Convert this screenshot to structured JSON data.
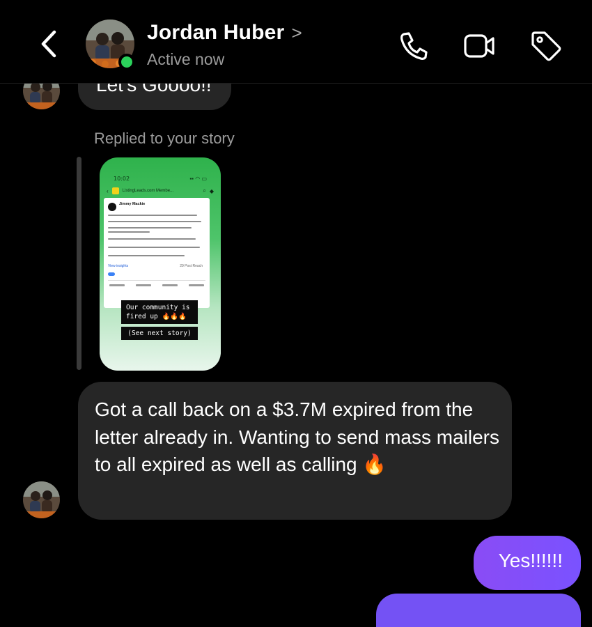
{
  "header": {
    "back_icon": "chevron-left-icon",
    "contact_name": "Jordan Huber",
    "name_chevron": ">",
    "status": "Active now",
    "status_color": "#2bd25b",
    "actions": [
      "phone-icon",
      "video-camera-icon",
      "tag-icon"
    ]
  },
  "messages": {
    "partial_text": "Let's Goooo!!",
    "reply_label": "Replied to your story",
    "story": {
      "time": "10:02",
      "app_bar_title": "ListingLeads.com Membe...",
      "post_author": "Jimmy Mackie",
      "view_insights": "View insights",
      "reach": "29 Post Reach",
      "caption_line1": "Our community is",
      "caption_line2": "fired up 🔥🔥🔥",
      "next_story": "(See next story)"
    },
    "incoming_text": "Got a call back on a $3.7M expired from the letter already in. Wanting to send mass mailers to all expired as well as calling 🔥",
    "outgoing_text": "Yes!!!!!!",
    "accent_color": "#7c4dff"
  }
}
